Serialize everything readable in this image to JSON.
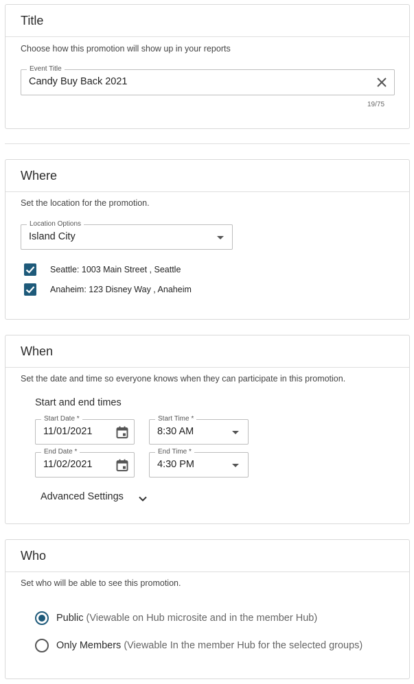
{
  "title_section": {
    "heading": "Title",
    "description": "Choose how this promotion will show up in your reports",
    "event_title_label": "Event Title",
    "event_title_value": "Candy Buy Back 2021",
    "char_counter": "19/75"
  },
  "where_section": {
    "heading": "Where",
    "description": "Set the location for the promotion.",
    "location_label": "Location Options",
    "location_value": "Island City",
    "locations": [
      {
        "label": "Seattle: 1003 Main Street , Seattle",
        "checked": true
      },
      {
        "label": "Anaheim: 123 Disney Way , Anaheim",
        "checked": true
      }
    ]
  },
  "when_section": {
    "heading": "When",
    "description": "Set the date and time so everyone knows when they can participate in this promotion.",
    "subheading": "Start and end times",
    "start_date_label": "Start Date *",
    "start_date_value": "11/01/2021",
    "start_time_label": "Start Time *",
    "start_time_value": "8:30 AM",
    "end_date_label": "End Date *",
    "end_date_value": "11/02/2021",
    "end_time_label": "End Time *",
    "end_time_value": "4:30 PM",
    "advanced_settings": "Advanced Settings"
  },
  "who_section": {
    "heading": "Who",
    "description": "Set who will be able to see this promotion.",
    "options": [
      {
        "label": "Public",
        "detail": "(Viewable on Hub microsite and in the member Hub)",
        "selected": true
      },
      {
        "label": "Only Members",
        "detail": "(Viewable In the member Hub for the selected groups)",
        "selected": false
      }
    ]
  },
  "colors": {
    "accent": "#1e5a7a",
    "border": "#d9d9d9"
  },
  "icons": [
    "close-icon",
    "caret-down-icon",
    "check-icon",
    "calendar-icon",
    "chevron-down-icon"
  ]
}
